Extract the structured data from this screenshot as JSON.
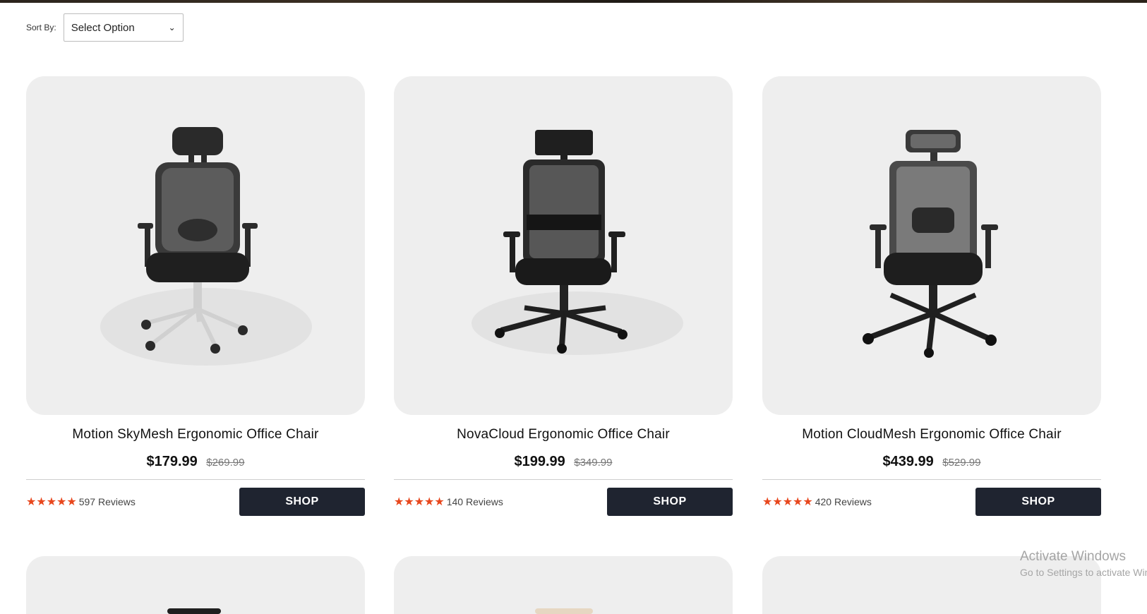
{
  "sort": {
    "label": "Sort By:",
    "selected": "Select Option"
  },
  "products": [
    {
      "title": "Motion SkyMesh Ergonomic Office Chair",
      "price": "$179.99",
      "old_price": "$269.99",
      "stars": "★★★★★",
      "reviews": "597 Reviews",
      "button": "SHOP",
      "base": "chrome"
    },
    {
      "title": "NovaCloud Ergonomic Office Chair",
      "price": "$199.99",
      "old_price": "$349.99",
      "stars": "★★★★★",
      "reviews": "140 Reviews",
      "button": "SHOP",
      "base": "black"
    },
    {
      "title": "Motion CloudMesh Ergonomic Office Chair",
      "price": "$439.99",
      "old_price": "$529.99",
      "stars": "★★★★★",
      "reviews": "420 Reviews",
      "button": "SHOP",
      "base": "black"
    }
  ],
  "watermark": {
    "title": "Activate Windows",
    "subtitle": "Go to Settings to activate Windows."
  },
  "colors": {
    "star": "#e8471d",
    "button_bg": "#1f2430",
    "card_bg": "#eeeeee"
  }
}
